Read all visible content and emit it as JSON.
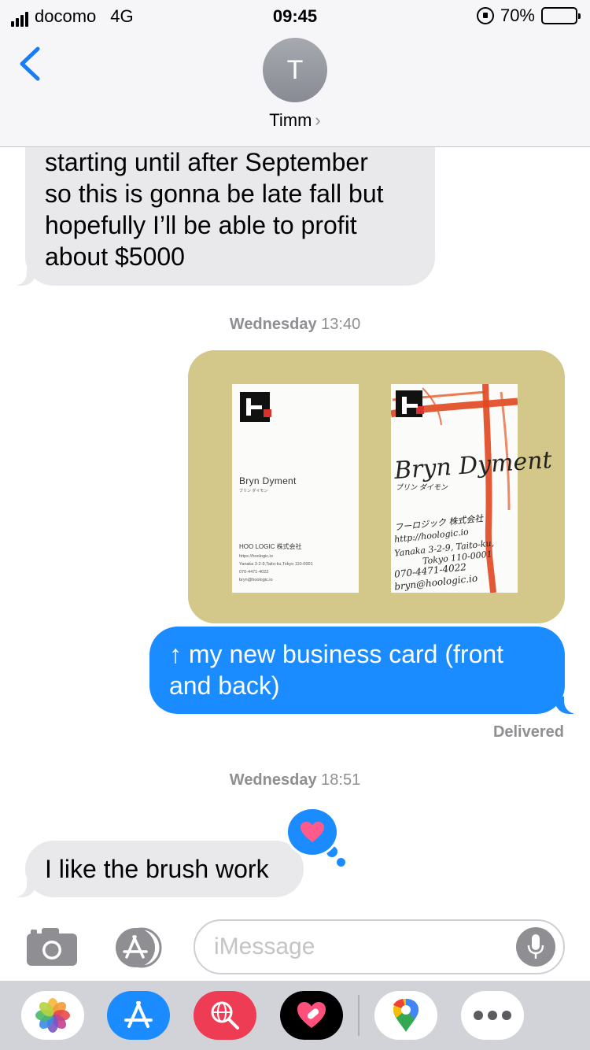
{
  "status_bar": {
    "carrier": "docomo",
    "network": "4G",
    "time": "09:45",
    "battery": "70%",
    "battery_level": 0.7
  },
  "header": {
    "avatar_initial": "T",
    "contact_name": "Timm",
    "chevron": "›",
    "back_icon": "chevron-left-icon"
  },
  "messages": [
    {
      "direction": "received",
      "text": "starting until after September\nso this is gonna be late fall but\nhopefully I’ll be able to profit\nabout $5000"
    },
    {
      "direction": "sent",
      "text": "↑ my new business card (front\nand back)"
    },
    {
      "direction": "received",
      "text": "I like the brush work",
      "tapback": "heart"
    }
  ],
  "timestamps": [
    {
      "day": "Wednesday",
      "time": "13:40"
    },
    {
      "day": "Wednesday",
      "time": "18:51"
    }
  ],
  "delivered_label": "Delivered",
  "attachment": {
    "front": {
      "name": "Bryn Dyment",
      "kana": "ブリン ダイモン",
      "company": "HOO LOGIC 株式会社",
      "lines": [
        "https://hoologic.io",
        "Yanaka 3-2-9,Taito-ku,Tokyo 110-0001",
        "070-4471-4022",
        "bryn@hoologic.io"
      ]
    },
    "back": {
      "name": "Bryn Dyment",
      "kana": "ブリン ダイモン",
      "company": "フーロジック 株式会社",
      "lines": [
        "http://hoologic.io",
        "Yanaka 3-2-9, Taito-ku,",
        "Tokyo 110-0001",
        "070-4471-4022",
        "bryn@hoologic.io"
      ]
    }
  },
  "input": {
    "placeholder": "iMessage"
  },
  "app_drawer": [
    "photos-app",
    "app-store",
    "web-search",
    "digital-touch",
    "google-maps",
    "more"
  ],
  "colors": {
    "sent_bubble": "#1a8cff",
    "received_bubble": "#e9e9eb",
    "photo_background": "#d3c789",
    "accent": "#1a7cf5"
  }
}
